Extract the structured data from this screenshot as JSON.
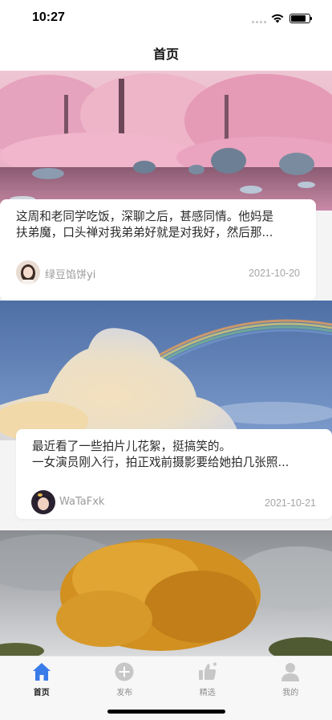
{
  "status_bar": {
    "time": "10:27"
  },
  "header": {
    "title": "首页"
  },
  "posts": [
    {
      "image": "pink-blossom-lake",
      "text_lines": [
        "这周和老同学吃饭，深聊之后，甚感同情。他妈是",
        "扶弟魔，口头禅对我弟弟好就是对我好，然后那..."
      ],
      "author": "绿豆馅饼yi",
      "date": "2021-10-20"
    },
    {
      "image": "cloud-rainbow-sky",
      "text_lines": [
        "最近看了一些拍片儿花絮，挺搞笑的。",
        "一女演员刚入行，拍正戏前摄影要给她拍几张照..."
      ],
      "author": "WaTaFxk",
      "date": "2021-10-21"
    },
    {
      "image": "autumn-golden-tree"
    }
  ],
  "tab_bar": {
    "tabs": [
      {
        "label": "首页",
        "icon": "home-icon",
        "active": true
      },
      {
        "label": "发布",
        "icon": "plus-circle-icon",
        "active": false
      },
      {
        "label": "精选",
        "icon": "thumbs-up-icon",
        "active": false
      },
      {
        "label": "我的",
        "icon": "person-icon",
        "active": false
      }
    ]
  },
  "colors": {
    "accent": "#3a7bea",
    "tab_inactive": "#c7c7c7",
    "background": "#f4f4f5"
  }
}
